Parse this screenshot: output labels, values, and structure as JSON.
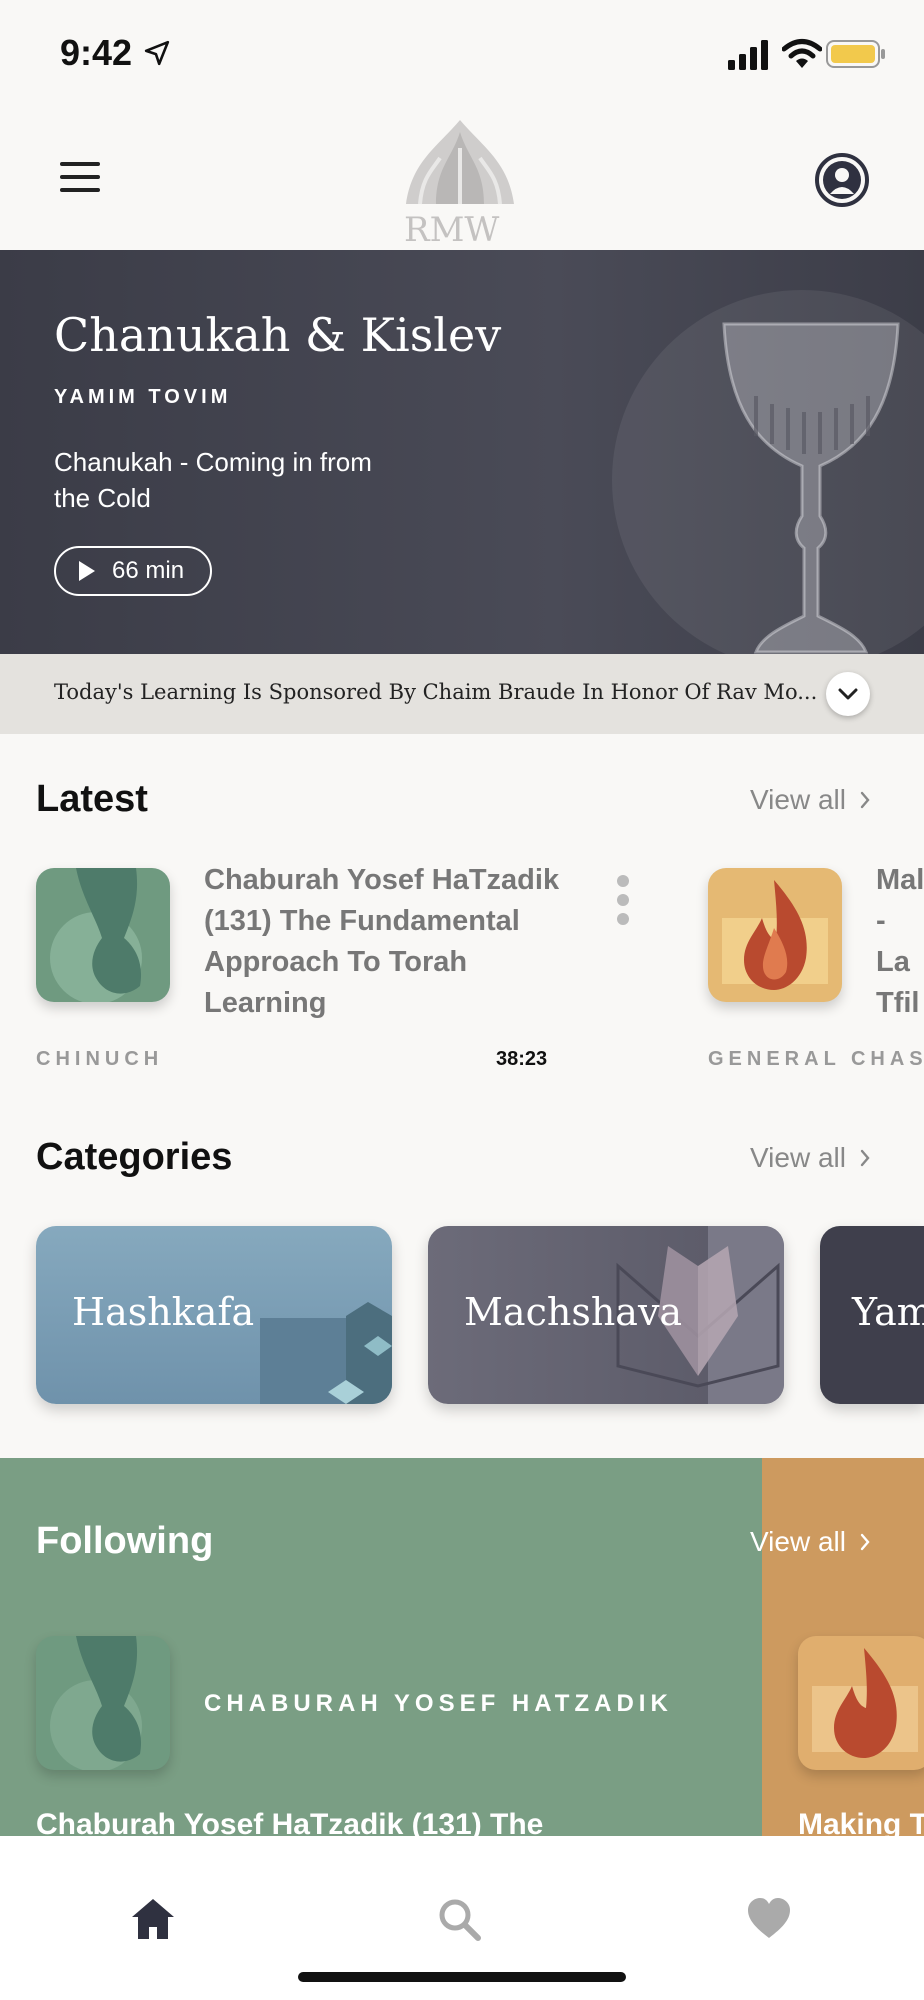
{
  "status_bar": {
    "time": "9:42"
  },
  "header": {
    "logo_text": "RMW"
  },
  "hero": {
    "title": "Chanukah & Kislev",
    "subtitle": "YAMIM TOVIM",
    "description": "Chanukah - Coming in from the Cold",
    "duration": "66 min"
  },
  "sponsor": {
    "text": "Today's Learning Is Sponsored By Chaim Braude In Honor Of Rav Mo..."
  },
  "latest": {
    "title": "Latest",
    "view_all": "View all",
    "items": [
      {
        "title": "Chaburah Yosef HaTzadik (131) The Fundamental Approach To Torah Learning",
        "category": "CHINUCH",
        "duration": "38:23",
        "thumb_color": "#6f9a80"
      },
      {
        "title": "Mal - La Tfil",
        "category": "GENERAL CHAS",
        "thumb_color": "#e5b973"
      }
    ]
  },
  "categories": {
    "title": "Categories",
    "view_all": "View all",
    "items": [
      {
        "label": "Hashkafa",
        "color": "#7c9fb6"
      },
      {
        "label": "Machshava",
        "color": "#62606f"
      },
      {
        "label": "Yam",
        "color": "#3f3f4c"
      }
    ]
  },
  "following": {
    "title": "Following",
    "view_all": "View all",
    "items": [
      {
        "name": "CHABURAH YOSEF HATZADIK",
        "title": "Chaburah Yosef HaTzadik (131) The",
        "color": "#7a9e84"
      },
      {
        "title": "Making T",
        "color": "#cd9a5f"
      }
    ]
  },
  "tabs": [
    {
      "icon": "home-icon",
      "label": "Home"
    },
    {
      "icon": "search-icon",
      "label": "Search"
    },
    {
      "icon": "heart-icon",
      "label": "Favorites"
    }
  ],
  "colors": {
    "hero_bg": "#42434f",
    "accent_green": "#7a9e84",
    "accent_orange": "#cd9a5f",
    "battery": "#f2c94c"
  }
}
